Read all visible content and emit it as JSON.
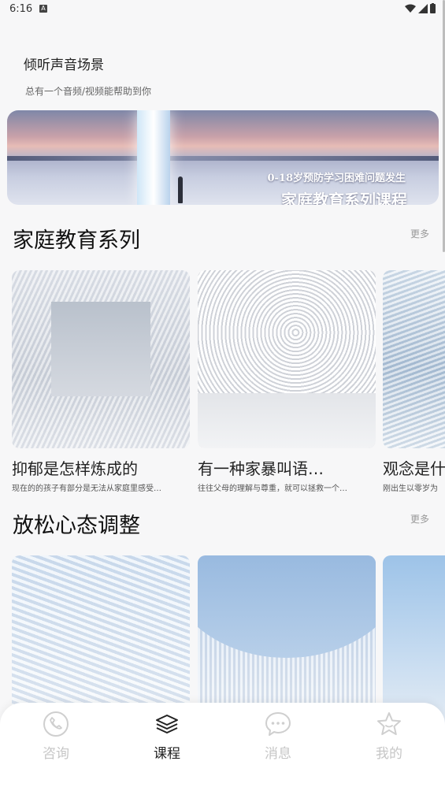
{
  "status_bar": {
    "time": "6:16",
    "notification_glyph": "A"
  },
  "header": {
    "title": "倾听声音场景",
    "subtitle": "总有一个音频/视频能帮助到你"
  },
  "banner": {
    "line1": "0-18岁预防学习困难问题发生",
    "line2": "家庭教育系列课程"
  },
  "sections": [
    {
      "title": "家庭教育系列",
      "more": "更多",
      "cards": [
        {
          "title": "抑郁是怎样炼成的",
          "desc": "现在的的孩子有部分是无法从家庭里感受…"
        },
        {
          "title": "有一种家暴叫语…",
          "desc": "往往父母的理解与尊重，就可以拯救一个…"
        },
        {
          "title": "观念是什",
          "desc": "刚出生以零岁为"
        }
      ]
    },
    {
      "title": "放松心态调整",
      "more": "更多",
      "cards": [
        {},
        {},
        {}
      ]
    }
  ],
  "tabbar": {
    "tabs": [
      {
        "label": "咨询",
        "icon": "consult-icon",
        "active": false
      },
      {
        "label": "课程",
        "icon": "layers-icon",
        "active": true
      },
      {
        "label": "消息",
        "icon": "message-icon",
        "active": false
      },
      {
        "label": "我的",
        "icon": "star-icon",
        "active": false
      }
    ]
  },
  "colors": {
    "background": "#f7f7f8",
    "active_tab": "#222222",
    "inactive_tab": "#c6c6c6"
  }
}
